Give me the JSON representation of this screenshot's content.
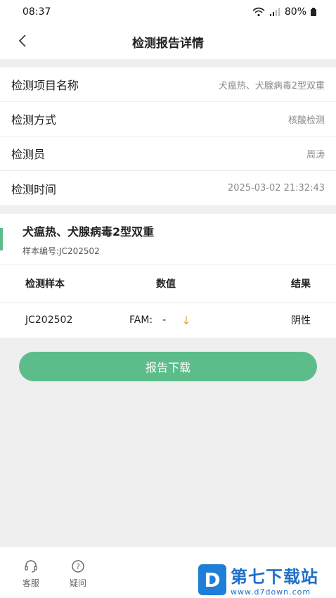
{
  "status_bar": {
    "time": "08:37",
    "battery": "80%"
  },
  "nav": {
    "title": "检测报告详情"
  },
  "info": [
    {
      "label": "检测项目名称",
      "value": "犬瘟热、犬腺病毒2型双重"
    },
    {
      "label": "检测方式",
      "value": "核酸检测"
    },
    {
      "label": "检测员",
      "value": "周涛"
    },
    {
      "label": "检测时间",
      "value": "2025-03-02 21:32:43"
    }
  ],
  "sample": {
    "name": "犬瘟热、犬腺病毒2型双重",
    "number": "样本编号:JC202502",
    "headers": [
      "检测样本",
      "数值",
      "结果"
    ],
    "row": {
      "sample": "JC202502",
      "channel": "FAM:",
      "value": "-",
      "result": "阴性"
    }
  },
  "download_label": "报告下载",
  "bottom_tabs": [
    {
      "label": "客服",
      "icon": "headset-icon"
    },
    {
      "label": "疑问",
      "icon": "question-icon"
    }
  ],
  "watermark": {
    "title": "第七下载站",
    "url": "www.d7down.com",
    "logo_letter": "D"
  },
  "colors": {
    "accent": "#5cbd8b",
    "arrow": "#e9a63a",
    "watermark": "#1f7fd8"
  }
}
